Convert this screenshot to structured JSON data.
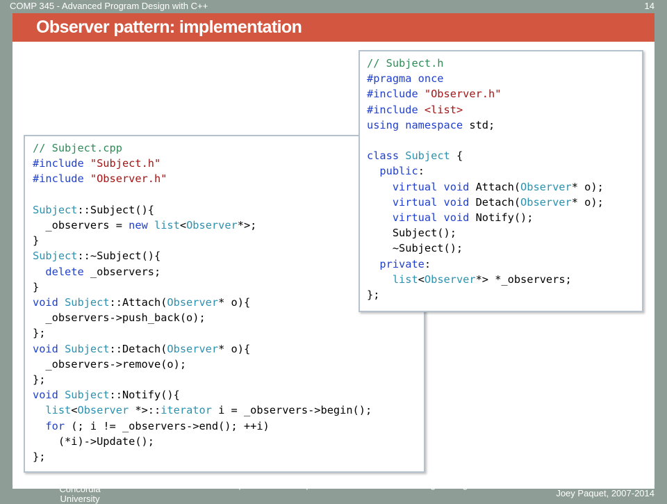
{
  "header": {
    "course": "COMP 345 - Advanced Program Design with C++",
    "page_number": "14"
  },
  "slide": {
    "title": "Observer pattern: implementation"
  },
  "code_cpp": {
    "lines": [
      [
        {
          "t": "// Subject.cpp",
          "c": "c"
        }
      ],
      [
        {
          "t": "#include ",
          "c": "k"
        },
        {
          "t": "\"Subject.h\"",
          "c": "s"
        }
      ],
      [
        {
          "t": "#include ",
          "c": "k"
        },
        {
          "t": "\"Observer.h\"",
          "c": "s"
        }
      ],
      [],
      [
        {
          "t": "Subject",
          "c": "t"
        },
        {
          "t": "::Subject(){"
        }
      ],
      [
        {
          "t": "  _observers = "
        },
        {
          "t": "new ",
          "c": "k"
        },
        {
          "t": "list",
          "c": "t"
        },
        {
          "t": "<"
        },
        {
          "t": "Observer",
          "c": "t"
        },
        {
          "t": "*>;"
        }
      ],
      [
        {
          "t": "}"
        }
      ],
      [
        {
          "t": "Subject",
          "c": "t"
        },
        {
          "t": "::~Subject(){"
        }
      ],
      [
        {
          "t": "  "
        },
        {
          "t": "delete",
          "c": "k"
        },
        {
          "t": " _observers;"
        }
      ],
      [
        {
          "t": "}"
        }
      ],
      [
        {
          "t": "void ",
          "c": "k"
        },
        {
          "t": "Subject",
          "c": "t"
        },
        {
          "t": "::Attach("
        },
        {
          "t": "Observer",
          "c": "t"
        },
        {
          "t": "* o){"
        }
      ],
      [
        {
          "t": "  _observers->push_back(o);"
        }
      ],
      [
        {
          "t": "};"
        }
      ],
      [
        {
          "t": "void ",
          "c": "k"
        },
        {
          "t": "Subject",
          "c": "t"
        },
        {
          "t": "::Detach("
        },
        {
          "t": "Observer",
          "c": "t"
        },
        {
          "t": "* o){"
        }
      ],
      [
        {
          "t": "  _observers->remove(o);"
        }
      ],
      [
        {
          "t": "};"
        }
      ],
      [
        {
          "t": "void ",
          "c": "k"
        },
        {
          "t": "Subject",
          "c": "t"
        },
        {
          "t": "::Notify(){"
        }
      ],
      [
        {
          "t": "  "
        },
        {
          "t": "list",
          "c": "t"
        },
        {
          "t": "<"
        },
        {
          "t": "Observer",
          "c": "t"
        },
        {
          "t": " *>::"
        },
        {
          "t": "iterator",
          "c": "t"
        },
        {
          "t": " i = _observers->begin();"
        }
      ],
      [
        {
          "t": "  "
        },
        {
          "t": "for",
          "c": "k"
        },
        {
          "t": " (; i != _observers->end(); ++i)"
        }
      ],
      [
        {
          "t": "    (*i)->Update();"
        }
      ],
      [
        {
          "t": "};"
        }
      ]
    ]
  },
  "code_h": {
    "lines": [
      [
        {
          "t": "// Subject.h",
          "c": "c"
        }
      ],
      [
        {
          "t": "#pragma once",
          "c": "k"
        }
      ],
      [
        {
          "t": "#include ",
          "c": "k"
        },
        {
          "t": "\"Observer.h\"",
          "c": "s"
        }
      ],
      [
        {
          "t": "#include ",
          "c": "k"
        },
        {
          "t": "<list>",
          "c": "s"
        }
      ],
      [
        {
          "t": "using namespace ",
          "c": "k"
        },
        {
          "t": "std;"
        }
      ],
      [],
      [
        {
          "t": "class ",
          "c": "k"
        },
        {
          "t": "Subject",
          "c": "t"
        },
        {
          "t": " {"
        }
      ],
      [
        {
          "t": "  "
        },
        {
          "t": "public",
          "c": "k"
        },
        {
          "t": ":"
        }
      ],
      [
        {
          "t": "    "
        },
        {
          "t": "virtual void ",
          "c": "k"
        },
        {
          "t": "Attach("
        },
        {
          "t": "Observer",
          "c": "t"
        },
        {
          "t": "* o);"
        }
      ],
      [
        {
          "t": "    "
        },
        {
          "t": "virtual void ",
          "c": "k"
        },
        {
          "t": "Detach("
        },
        {
          "t": "Observer",
          "c": "t"
        },
        {
          "t": "* o);"
        }
      ],
      [
        {
          "t": "    "
        },
        {
          "t": "virtual void ",
          "c": "k"
        },
        {
          "t": "Notify();"
        }
      ],
      [
        {
          "t": "    Subject();"
        }
      ],
      [
        {
          "t": "    ~Subject();"
        }
      ],
      [
        {
          "t": "  "
        },
        {
          "t": "private",
          "c": "k"
        },
        {
          "t": ":"
        }
      ],
      [
        {
          "t": "    "
        },
        {
          "t": "list",
          "c": "t"
        },
        {
          "t": "<"
        },
        {
          "t": "Observer",
          "c": "t"
        },
        {
          "t": "*> *_observers;"
        }
      ],
      [
        {
          "t": "};"
        }
      ]
    ]
  },
  "footer": {
    "left": "Concordia University",
    "middle": "Department of Computer Science and Software Engineering",
    "right": "Joey Paquet, 2007-2014"
  },
  "colors": {
    "background": "#8e9e97",
    "title_bar": "#d35740",
    "code_keyword": "#1f3fcc",
    "code_type": "#2b91af",
    "code_comment": "#2e8b57",
    "code_string": "#a31515"
  }
}
